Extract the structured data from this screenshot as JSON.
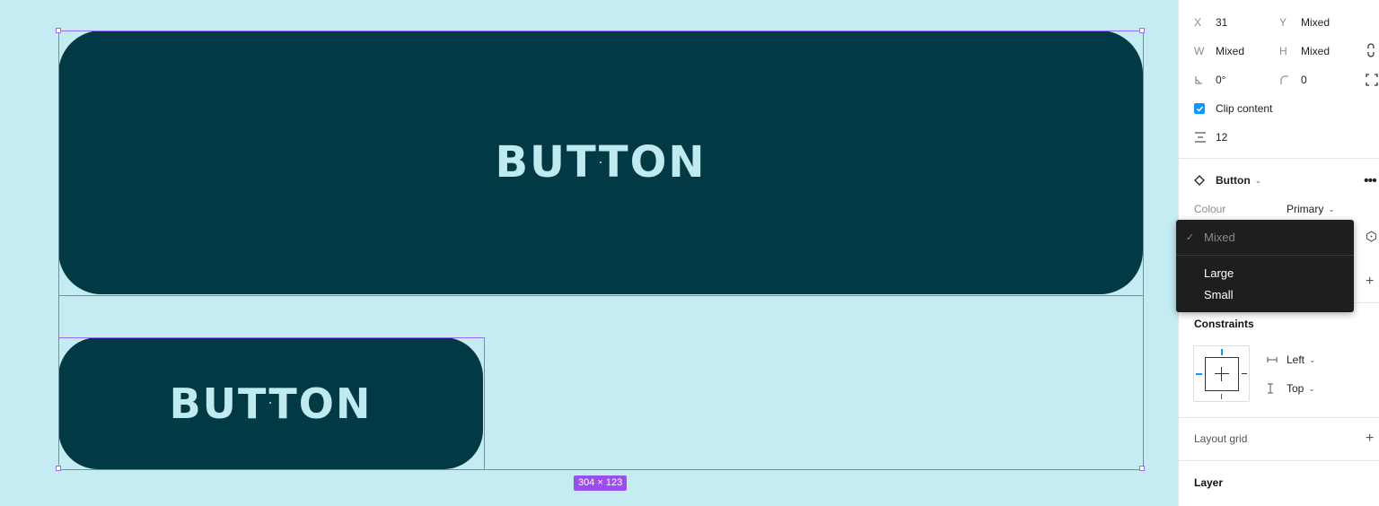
{
  "canvas": {
    "large_button_label": "BUTTON",
    "small_button_label": "BUTTON",
    "size_badge": "304 × 123"
  },
  "panel": {
    "x_label": "X",
    "x_value": "31",
    "y_label": "Y",
    "y_value": "Mixed",
    "w_label": "W",
    "w_value": "Mixed",
    "h_label": "H",
    "h_value": "Mixed",
    "rotation_value": "0°",
    "radius_value": "0",
    "clip_content_label": "Clip content",
    "clip_content_checked": true,
    "spacing_value": "12",
    "component_name": "Button",
    "colour_label": "Colour",
    "colour_value": "Primary",
    "constraints_title": "Constraints",
    "constraint_h": "Left",
    "constraint_v": "Top",
    "layout_grid_label": "Layout grid",
    "layer_title": "Layer"
  },
  "dropdown": {
    "selected": "Mixed",
    "options": [
      "Large",
      "Small"
    ]
  },
  "colors": {
    "canvas_bg": "#c4ecf2",
    "button_bg": "#013a44",
    "button_text": "#bfeaf0",
    "selection": "#9b6bf5",
    "accent": "#0d99ff"
  }
}
